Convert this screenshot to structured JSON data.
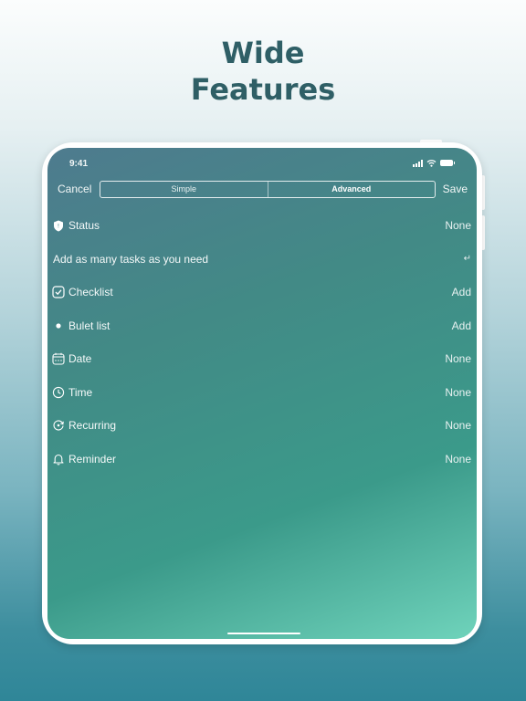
{
  "headline": {
    "line1": "Wide",
    "line2": "Features"
  },
  "status_bar": {
    "time": "9:41",
    "icons": [
      "signal-icon",
      "wifi-icon",
      "battery-icon"
    ]
  },
  "nav": {
    "cancel_label": "Cancel",
    "save_label": "Save",
    "segments": [
      {
        "label": "Simple",
        "selected": false
      },
      {
        "label": "Advanced",
        "selected": true
      }
    ]
  },
  "rows": {
    "status": {
      "label": "Status",
      "value": "None",
      "icon": "status-icon"
    },
    "task_input": {
      "placeholder": "Add as many tasks as you need",
      "icon": "return-icon"
    },
    "checklist": {
      "label": "Checklist",
      "value": "Add",
      "icon": "checkbox-icon"
    },
    "bullet": {
      "label": "Bulet list",
      "value": "Add",
      "icon": "bullet-icon"
    },
    "date": {
      "label": "Date",
      "value": "None",
      "icon": "calendar-icon"
    },
    "time": {
      "label": "Time",
      "value": "None",
      "icon": "clock-icon"
    },
    "recurring": {
      "label": "Recurring",
      "value": "None",
      "icon": "repeat-icon"
    },
    "reminder": {
      "label": "Reminder",
      "value": "None",
      "icon": "bell-icon"
    }
  },
  "colors": {
    "headline": "#2f5f66",
    "screen_gradient_start": "#4e7b8e",
    "screen_gradient_end": "#6fd3bb",
    "text": "#ffffff"
  }
}
